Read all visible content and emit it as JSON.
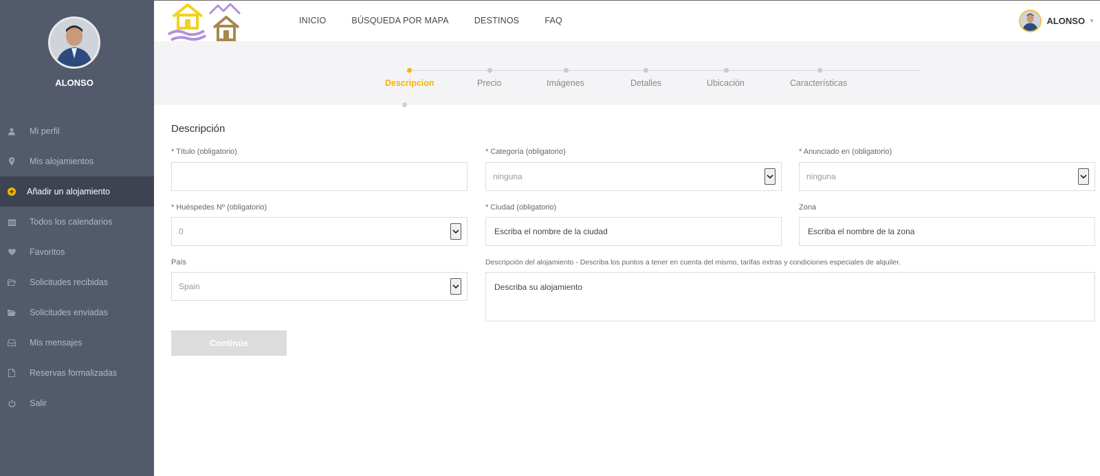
{
  "app": {
    "brand_colors": {
      "sidebar": "#525a6c",
      "accent": "#f5b400",
      "logo_yellow": "#f2d21b",
      "logo_purple": "#b48fdf",
      "logo_brown": "#a8874d"
    }
  },
  "sidebar": {
    "user_name": "ALONSO",
    "items": [
      {
        "label": "Mi perfil",
        "icon": "user-icon"
      },
      {
        "label": "Mis alojamientos",
        "icon": "map-pin-icon"
      },
      {
        "label": "Añadir un alojamiento",
        "icon": "plus-circle-icon",
        "active": true
      },
      {
        "label": "Todos los calendarios",
        "icon": "calendar-icon"
      },
      {
        "label": "Favoritos",
        "icon": "heart-icon"
      },
      {
        "label": "Solicitudes recibidas",
        "icon": "folder-open-icon"
      },
      {
        "label": "Solicitudes enviadas",
        "icon": "folder-open-filled-icon"
      },
      {
        "label": "Mis mensajes",
        "icon": "inbox-icon"
      },
      {
        "label": "Reservas formalizadas",
        "icon": "document-icon"
      },
      {
        "label": "Salir",
        "icon": "power-icon"
      }
    ]
  },
  "topbar": {
    "nav": [
      "INICIO",
      "BÚSQUEDA POR MAPA",
      "DESTINOS",
      "FAQ"
    ],
    "user_name": "ALONSO"
  },
  "stepper": {
    "steps": [
      "Descripcion",
      "Precio",
      "Imágenes",
      "Detalles",
      "Ubicación",
      "Características"
    ],
    "active_index": 0
  },
  "form": {
    "title": "Descripción",
    "titulo": {
      "label": "* Título (obligatorio)",
      "value": ""
    },
    "categoria": {
      "label": "* Categoría (obligatorio)",
      "value": "ninguna"
    },
    "anunciado": {
      "label": "* Anunciado en (obligatorio)",
      "value": "ninguna"
    },
    "huespedes": {
      "label": "* Huéspedes Nº (obligatorio)",
      "value": "0"
    },
    "ciudad": {
      "label": "* Ciudad (obligatorio)",
      "placeholder": "Escriba el nombre de la ciudad"
    },
    "zona": {
      "label": "Zona",
      "placeholder": "Escriba el nombre de la zona"
    },
    "pais": {
      "label": "País",
      "value": "Spain"
    },
    "descripcion": {
      "label": "Descripción del alojamiento - Describa los puntos a tener en cuenta del mismo, tarifas extras y condiciones especiales de alquiler.",
      "placeholder": "Describa su alojamiento"
    },
    "continue_label": "Continúe"
  }
}
